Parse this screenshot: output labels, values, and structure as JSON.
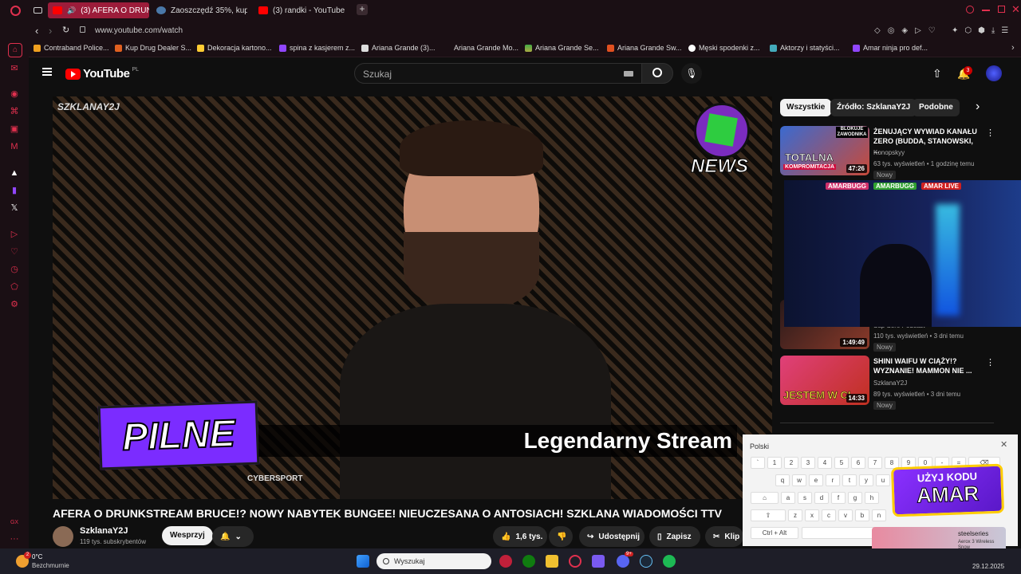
{
  "browser": {
    "tabs": [
      {
        "label": "(3) AFERA O DRUNKS"
      },
      {
        "label": "Zaoszczędź 35%, kupuj"
      },
      {
        "label": "(3) randki - YouTube"
      }
    ],
    "url": "www.youtube.com/watch",
    "bookmarks": [
      "Contraband Police...",
      "Kup Drug Dealer S...",
      "Dekoracja kartono...",
      "spina z kasjerem z...",
      "Ariana Grande (3)...",
      "Ariana Grande Mo...",
      "Ariana Grande Se...",
      "Ariana Grande Sw...",
      "Męski spodenki z...",
      "Aktorzy i statyści...",
      "Amar ninja pro def..."
    ]
  },
  "youtube": {
    "logo": "YouTube",
    "logo_region": "PL",
    "search_placeholder": "Szukaj",
    "notif_count": "3",
    "video": {
      "overlay_channel": "SZKLANAY2J",
      "overlay_news": "NEWS",
      "overlay_pilne": "PILNE",
      "overlay_caption": "Legendarny Stream",
      "overlay_brand": "CYBERSPORT",
      "title": "AFERA O DRUNKSTREAM BRUCE!? NOWY NABYTEK BUNGEE! NIEUCZESANA O ANTOSIACH! SZKLANA WIADOMOŚCI TTV",
      "channel": "SzklanaY2J",
      "subscribers": "119 tys. subskrybentów",
      "support_label": "Wesprzyj",
      "likes": "1,6 tys.",
      "share_label": "Udostępnij",
      "save_label": "Zapisz",
      "clip_label": "Klip"
    },
    "chips": [
      "Wszystkie",
      "Źródło: SzklanaY2J",
      "Podobne"
    ],
    "recommendations": [
      {
        "title": "ŻENUJĄCY WYWIAD KANAŁU ZERO (BUDDA, STANOWSKI, ...",
        "channel": "Konopskyy",
        "meta": "63 tys. wyświetleń • 1 godzinę temu",
        "badge": "Nowy",
        "duration": "47:26",
        "thumb_text1": "TOTALNA",
        "thumb_text2": "KOMPROMITACJA",
        "thumb_tag": "BLOKUJE ZAWODNIKA"
      },
      {
        "title": "",
        "channel": "Sup Sore Podcast",
        "meta": "110 tys. wyświetleń • 3 dni temu",
        "badge": "Nowy",
        "duration": "1:49:49"
      },
      {
        "title": "SHINI WAIFU W CIĄŻY!? WYZNANIE! MAMMON NIE ...",
        "channel": "SzklanaY2J",
        "meta": "89 tys. wyświetleń • 3 dni temu",
        "badge": "Nowy",
        "duration": "14:33",
        "thumb_text1": "JESTEM W CI"
      }
    ]
  },
  "pip": {
    "handles": [
      "AMARBUGG",
      "AMARBUGG",
      "AMAR LIVE"
    ]
  },
  "keyboard": {
    "language": "Polski",
    "row1": [
      "`",
      "1",
      "2",
      "3",
      "4",
      "5",
      "6",
      "7",
      "8",
      "9",
      "0",
      "-",
      "="
    ],
    "row2": [
      "q",
      "w",
      "e",
      "r",
      "t",
      "y",
      "u"
    ],
    "row3": [
      "a",
      "s",
      "d",
      "f",
      "g",
      "h"
    ],
    "row4": [
      "z",
      "x",
      "c",
      "v",
      "b",
      "n"
    ],
    "ctrl_label": "Ctrl + Alt"
  },
  "promo": {
    "line1": "UŻYJ KODU",
    "line2": "AMAR",
    "brand": "steelseries",
    "product": "Aerox 3 Wireless Snow"
  },
  "taskbar": {
    "weather_temp": "0°C",
    "weather_desc": "Bezchmurnie",
    "weather_badge": "2",
    "search_label": "Wyszukaj",
    "date": "29.12.2025",
    "discord_badge": "9+"
  }
}
